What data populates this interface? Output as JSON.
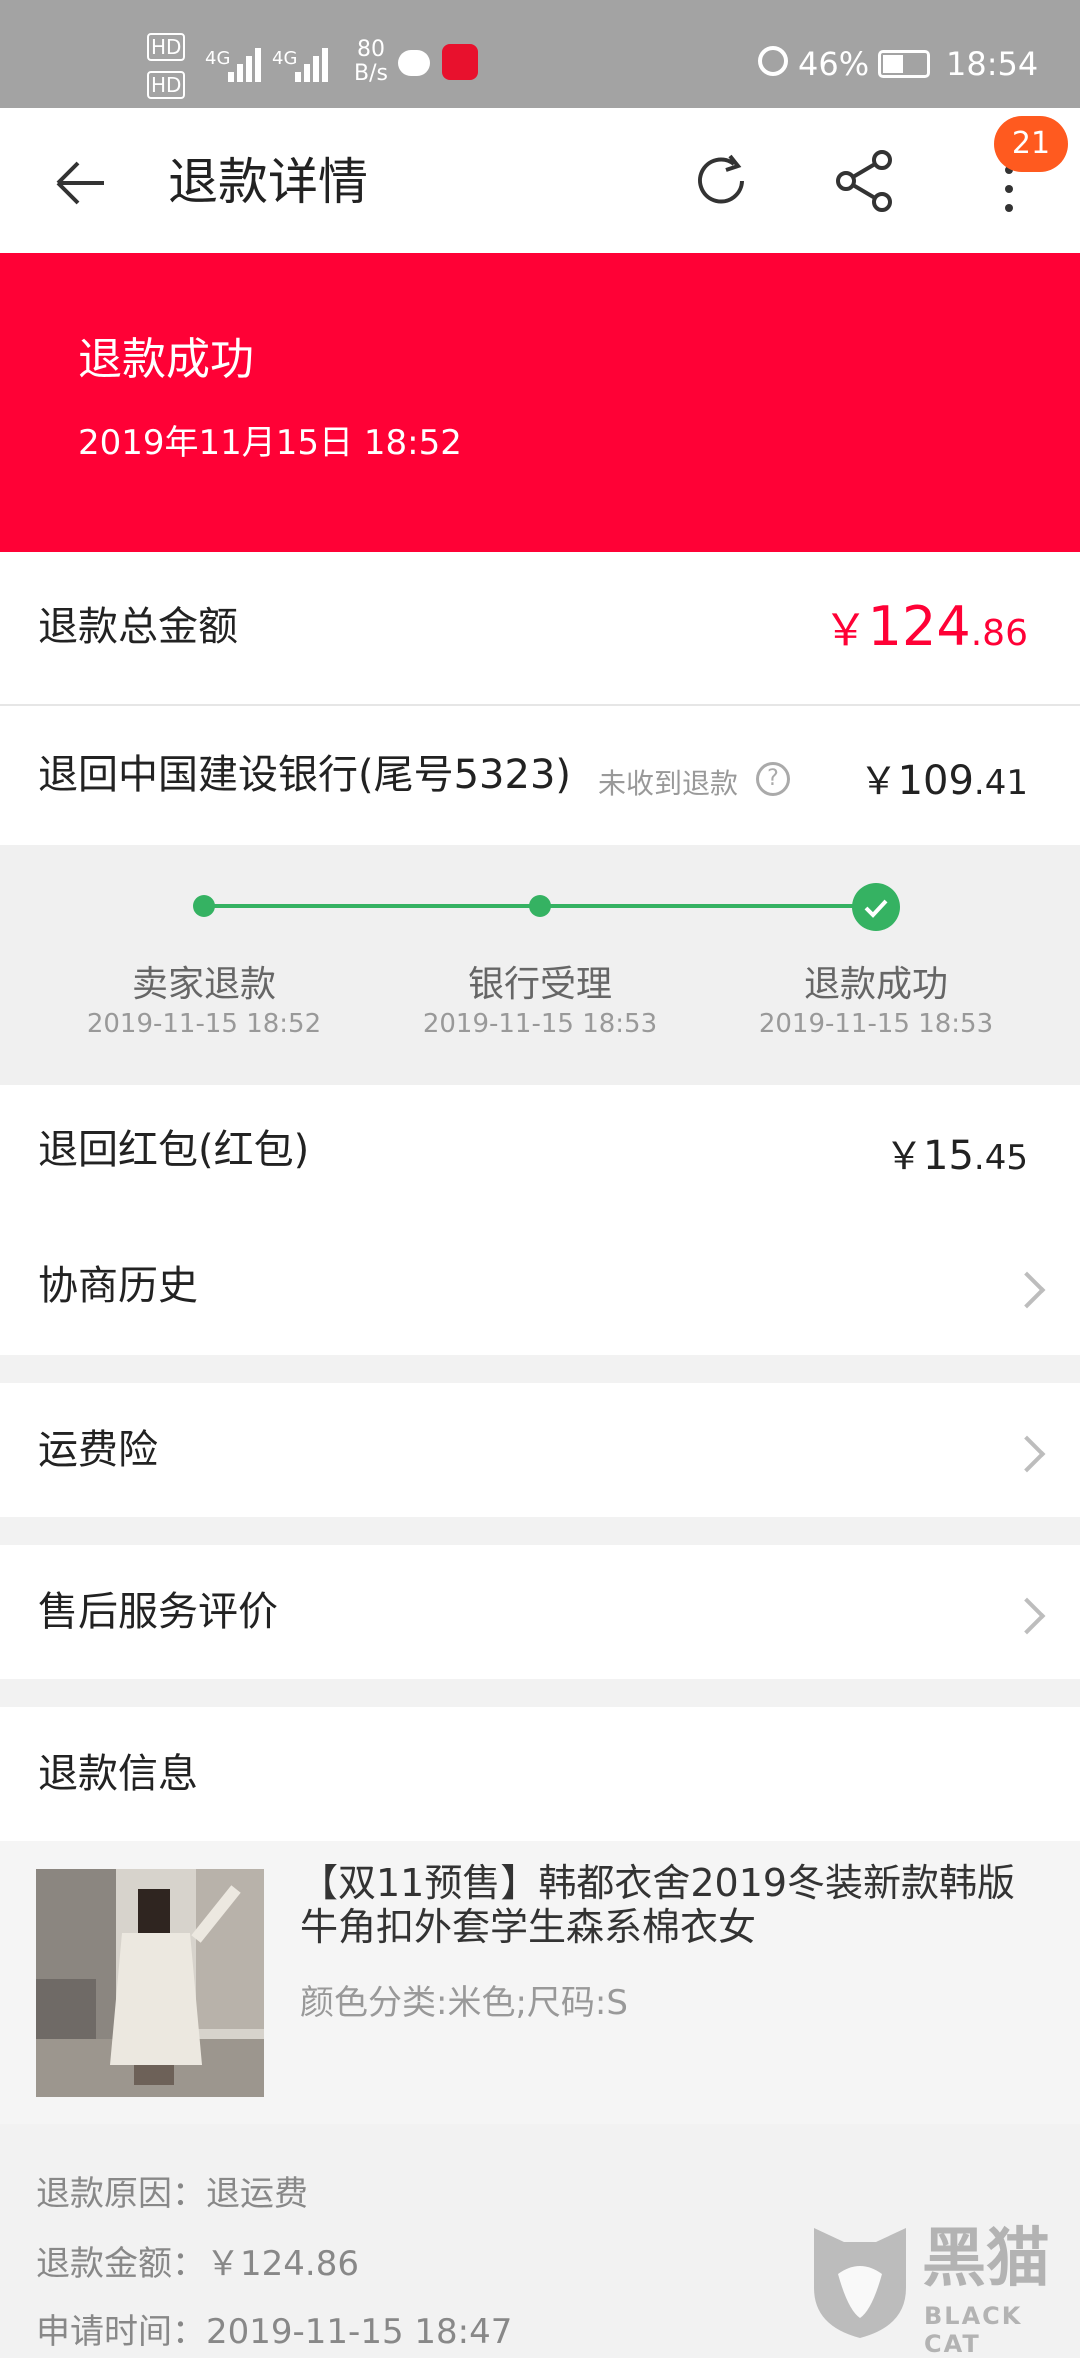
{
  "status_bar": {
    "hd1": "HD",
    "hd2": "HD",
    "net1": "4G",
    "net2": "4G",
    "speed_value": "80",
    "speed_unit": "B/s",
    "battery": "46%",
    "time": "18:54"
  },
  "header": {
    "title": "退款详情",
    "badge": "21"
  },
  "banner": {
    "title": "退款成功",
    "time": "2019年11月15日 18:52"
  },
  "total": {
    "label": "退款总金额",
    "currency": "￥",
    "amount_int": "124",
    "amount_dec": ".86"
  },
  "bank": {
    "label": "退回中国建设银行(尾号5323)",
    "not_received": "未收到退款",
    "currency": "￥",
    "amount_int": "109",
    "amount_dec": ".41"
  },
  "progress": {
    "steps": [
      {
        "title": "卖家退款",
        "time": "2019-11-15 18:52"
      },
      {
        "title": "银行受理",
        "time": "2019-11-15 18:53"
      },
      {
        "title": "退款成功",
        "time": "2019-11-15 18:53"
      }
    ]
  },
  "redpacket": {
    "label": "退回红包(红包)",
    "currency": "￥",
    "amount_int": "15",
    "amount_dec": ".45"
  },
  "menu": {
    "history": "协商历史",
    "insurance": "运费险",
    "evaluation": "售后服务评价"
  },
  "refund_info": {
    "heading": "退款信息",
    "product_title": "【双11预售】韩都衣舍2019冬装新款韩版牛角扣外套学生森系棉衣女",
    "product_sku": "颜色分类:米色;尺码:S",
    "reason_label": "退款原因：",
    "reason_value": "退运费",
    "amount_label": "退款金额：",
    "amount_value": "￥124.86",
    "apply_label": "申请时间：",
    "apply_value": "2019-11-15 18:47"
  },
  "watermark": {
    "cn": "黑猫",
    "en": "BLACK CAT"
  },
  "colors": {
    "accent": "#ff0136",
    "progress_green": "#35b262",
    "badge": "#ff5a1f"
  }
}
